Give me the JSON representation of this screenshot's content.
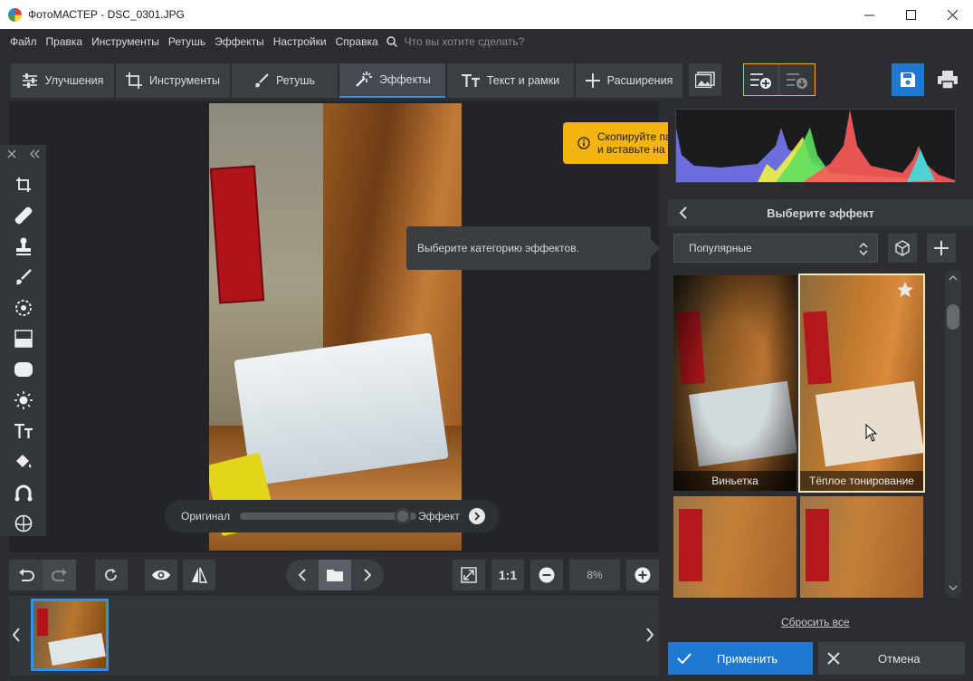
{
  "window": {
    "title": "ФотоМАСТЕР - DSC_0301.JPG"
  },
  "menu": {
    "items": [
      "Файл",
      "Правка",
      "Инструменты",
      "Ретушь",
      "Эффекты",
      "Настройки",
      "Справка"
    ],
    "search_placeholder": "Что вы хотите сделать?"
  },
  "tabs": [
    {
      "label": "Улучшения",
      "icon": "sliders-icon"
    },
    {
      "label": "Инструменты",
      "icon": "crop-icon"
    },
    {
      "label": "Ретушь",
      "icon": "brush-icon"
    },
    {
      "label": "Эффекты",
      "icon": "magic-wand-icon",
      "active": true
    },
    {
      "label": "Текст и рамки",
      "icon": "text-icon"
    },
    {
      "label": "Расширения",
      "icon": "plus-icon"
    }
  ],
  "tooltips": {
    "category": "Выберите категорию эффектов.",
    "copy_line1": "Скопируйте параметры обработки",
    "copy_line2": "и вставьте на другое фото"
  },
  "compare": {
    "original_label": "Оригинал",
    "effect_label": "Эффект"
  },
  "zoom": {
    "one_to_one": "1:1",
    "value": "8%"
  },
  "panel": {
    "title": "Выберите эффект",
    "category_selected": "Популярные",
    "effects": [
      {
        "label": "Виньетка",
        "selected": false
      },
      {
        "label": "Тёплое тонирование",
        "selected": true
      }
    ],
    "reset_label": "Сбросить все",
    "apply_label": "Применить",
    "cancel_label": "Отмена"
  },
  "colors": {
    "accent": "#1f78d1",
    "tooltip": "#f5b30f",
    "active_tab_line": "#3d8fdb"
  }
}
